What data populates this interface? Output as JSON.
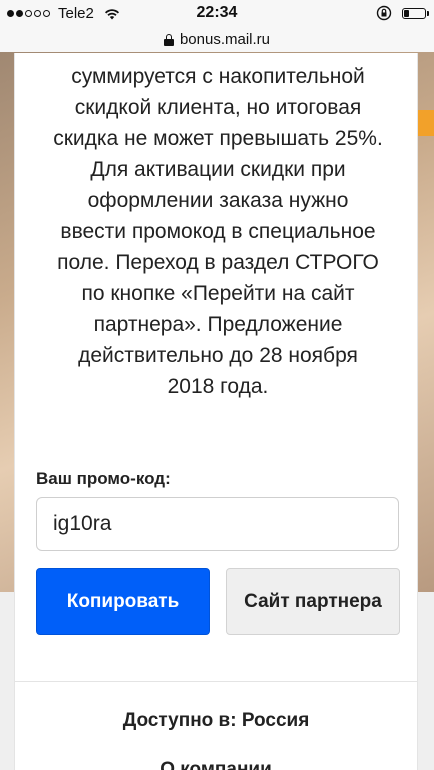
{
  "status_bar": {
    "carrier": "Tele2",
    "time": "22:34",
    "signal_filled": 2,
    "signal_total": 5,
    "battery_level": 0.2
  },
  "address_bar": {
    "domain": "bonus.mail.ru",
    "lock_icon": "lock-icon"
  },
  "offer": {
    "description_lines": [
      "суммируется с накопительной",
      "скидкой клиента, но итоговая",
      "скидка не может превышать 25%.",
      "Для активации скидки при",
      "оформлении заказа нужно",
      "ввести промокод в специальное",
      "поле. Переход в раздел СТРОГО",
      "по кнопке «Перейти на сайт",
      "партнера». Предложение",
      "действительно до 28 ноября",
      "2018 года."
    ],
    "promo_label": "Ваш промо-код:",
    "promo_code": "ig10ra",
    "copy_button": "Копировать",
    "partner_button": "Сайт партнера",
    "available_in": "Доступно в: Россия",
    "about_company": "О компании"
  },
  "colors": {
    "primary_button": "#005ff9",
    "secondary_button": "#efefef",
    "accent_orange": "#f2a12a"
  }
}
